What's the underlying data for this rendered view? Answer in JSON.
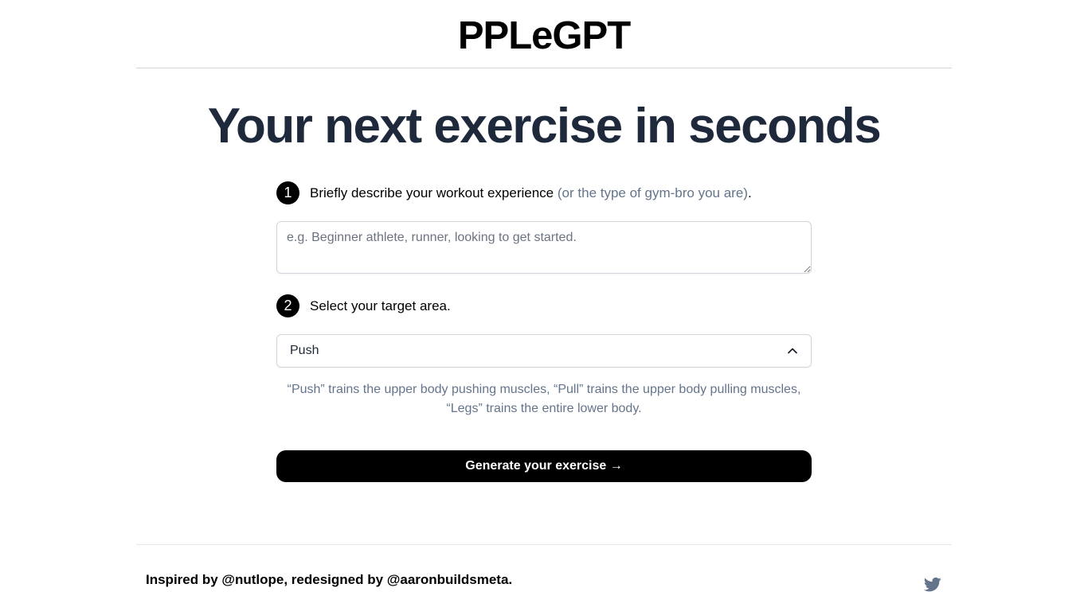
{
  "header": {
    "brand": "PPLeGPT"
  },
  "hero": {
    "title": "Your next exercise in seconds"
  },
  "steps": [
    {
      "number": "1",
      "text": "Briefly describe your workout experience",
      "muted": "(or the type of gym-bro you are)",
      "suffix": "."
    },
    {
      "number": "2",
      "text": "Select your target area."
    }
  ],
  "experience_input": {
    "value": "",
    "placeholder": "e.g. Beginner athlete, runner, looking to get started."
  },
  "target_select": {
    "selected": "Push",
    "icon": "chevron-up-icon"
  },
  "help_text": "“Push” trains the upper body pushing muscles, “Pull” trains the upper body pulling muscles, “Legs” trains the entire lower body.",
  "generate_button": {
    "label": "Generate your exercise →"
  },
  "footer": {
    "credit": "Inspired by @nutlope, redesigned by @aaronbuildsmeta.",
    "social_icon": "twitter-icon"
  },
  "colors": {
    "heading": "#1e293b",
    "muted": "#64748b",
    "button_bg": "#000000",
    "twitter_icon": "#64748b"
  }
}
